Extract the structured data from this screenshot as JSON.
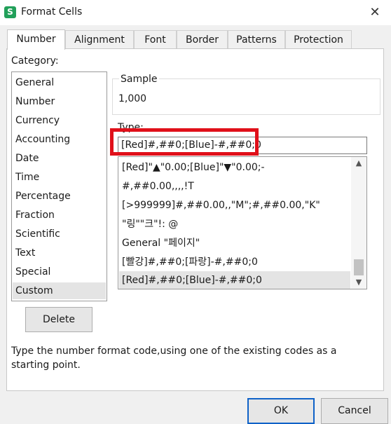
{
  "window": {
    "title": "Format Cells",
    "app_icon": "S",
    "close_label": "✕"
  },
  "tabs": [
    "Number",
    "Alignment",
    "Font",
    "Border",
    "Patterns",
    "Protection"
  ],
  "category": {
    "label": "Category:",
    "items": [
      "General",
      "Number",
      "Currency",
      "Accounting",
      "Date",
      "Time",
      "Percentage",
      "Fraction",
      "Scientific",
      "Text",
      "Special",
      "Custom"
    ],
    "selected": "Custom"
  },
  "sample": {
    "label": "Sample",
    "value": "1,000"
  },
  "type": {
    "label": "Type:",
    "value": "[Red]#,##0;[Blue]-#,##0;0",
    "items": [
      "[Red]\"▲\"0.00;[Blue]\"▼\"0.00;-",
      "#,##0.00,,,,!T",
      "[>999999]#,##0.00,,\"M\";#,##0.00,\"K\"",
      "\"링\"\"크\"!: @",
      "General \"페이지\"",
      "[빨강]#,##0;[파랑]-#,##0;0",
      "[Red]#,##0;[Blue]-#,##0;0"
    ],
    "selected": "[Red]#,##0;[Blue]-#,##0;0"
  },
  "buttons": {
    "delete": "Delete",
    "ok": "OK",
    "cancel": "Cancel"
  },
  "description": "Type the number format code,using one of the existing codes as a starting point.",
  "colors": {
    "highlight": "#e0101a",
    "focus": "#0f62c8",
    "selection": "#e4e4e4"
  }
}
